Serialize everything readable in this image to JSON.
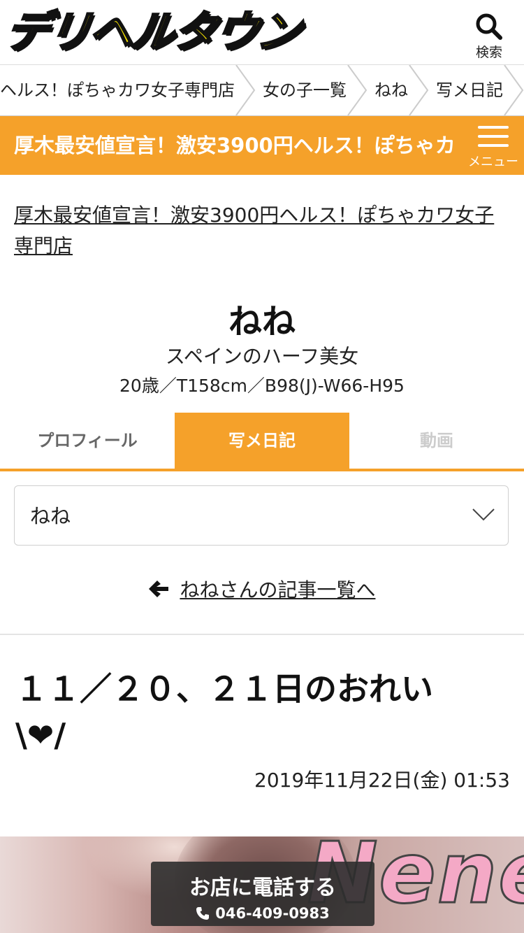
{
  "header": {
    "logo_text": "デリヘルタウン",
    "search_label": "検索"
  },
  "breadcrumb": {
    "items": [
      "ヘルス！ぽちゃカワ女子専門店",
      "女の子一覧",
      "ねね",
      "写メ日記"
    ]
  },
  "shop_bar": {
    "title": "厚木最安値宣言！激安3900円ヘルス！ぽちゃカ",
    "menu_label": "メニュー"
  },
  "shop_link": "厚木最安値宣言！激安3900円ヘルス！ぽちゃカワ女子専門店",
  "girl": {
    "name": "ねね",
    "catch": "スペインのハーフ美女",
    "spec": "20歳／T158cm／B98(J)-W66-H95"
  },
  "tabs": [
    "プロフィール",
    "写メ日記",
    "動画"
  ],
  "select": {
    "value": "ねね"
  },
  "back_link": "ねねさんの記事一覧へ",
  "post": {
    "title": "１１／２０、２１日のおれい\\❤/",
    "date": "2019年11月22日(金) 01:53"
  },
  "photo": {
    "overlay_text": "Nene"
  },
  "call": {
    "label": "お店に電話する",
    "number": "046-409-0983"
  },
  "colors": {
    "accent": "#f5a12a",
    "logo_yellow": "#f7e400"
  }
}
